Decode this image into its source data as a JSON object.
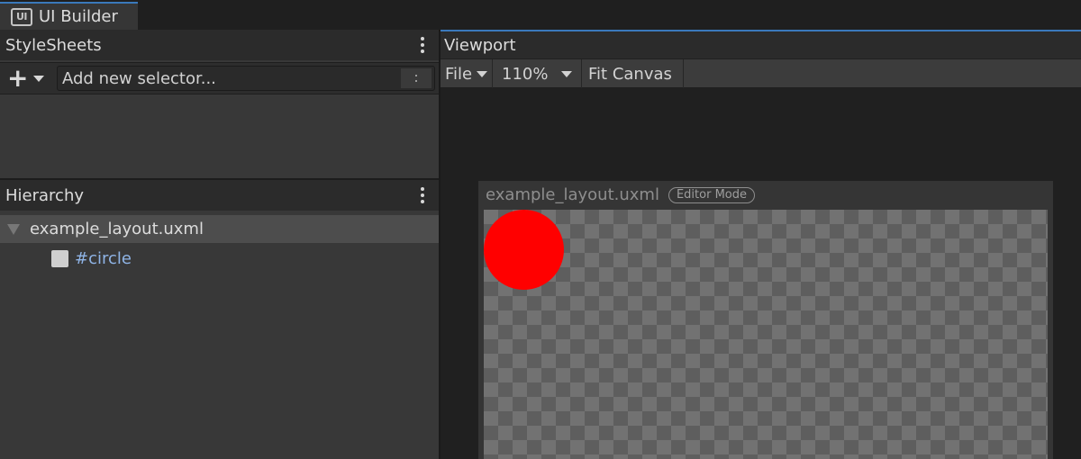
{
  "window_tab": {
    "icon_text": "UI",
    "label": "UI Builder"
  },
  "stylesheets": {
    "title": "StyleSheets",
    "add_icon": "plus-icon",
    "selector_placeholder": "Add new selector..."
  },
  "hierarchy": {
    "title": "Hierarchy",
    "root": {
      "label": "example_layout.uxml"
    },
    "children": [
      {
        "label": "#circle",
        "icon": "visual-element-icon"
      }
    ]
  },
  "viewport": {
    "title": "Viewport",
    "toolbar": {
      "file_label": "File",
      "zoom_label": "110%",
      "fit_label": "Fit Canvas"
    },
    "canvas": {
      "document_name": "example_layout.uxml",
      "mode_badge": "Editor Mode",
      "circle_color": "#ff0000"
    }
  },
  "colors": {
    "accent": "#3a79bb",
    "selector_link": "#8fb4e6"
  }
}
